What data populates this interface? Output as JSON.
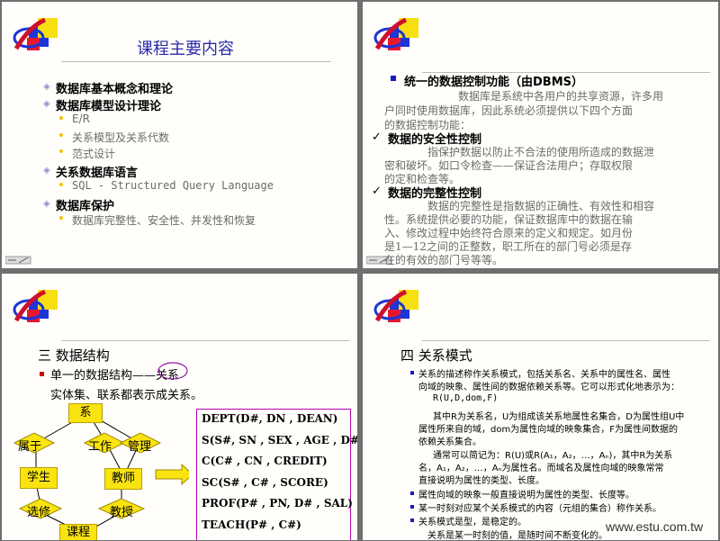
{
  "watermark": "www.estu.com.tw",
  "slide1": {
    "title": "课程主要内容",
    "items": [
      {
        "level": 1,
        "text": "数据库基本概念和理论"
      },
      {
        "level": 1,
        "text": "数据库模型设计理论"
      },
      {
        "level": 2,
        "text": "E/R"
      },
      {
        "level": 2,
        "text": "关系模型及关系代数"
      },
      {
        "level": 2,
        "text": "范式设计"
      },
      {
        "level": 1,
        "text": "关系数据库语言"
      },
      {
        "level": 2,
        "text": "SQL - Structured Query Language"
      },
      {
        "level": 1,
        "text": "数据库保护"
      },
      {
        "level": 2,
        "text": "数据库完整性、安全性、并发性和恢复"
      }
    ]
  },
  "slide2": {
    "heading": "统一的数据控制功能（由DBMS）",
    "intro": [
      "数据库是系统中各用户的共享资源，许多用",
      "户同时使用数据库，因此系统必须提供以下四个方面",
      "的数据控制功能："
    ],
    "security_title": "数据的安全性控制",
    "security_text": [
      "指保护数据以防止不合法的使用所造成的数据泄",
      "密和破坏。如口令检查——保证合法用户；存取权限",
      "的定和检查等。"
    ],
    "integrity_title": "数据的完整性控制",
    "integrity_text": [
      "数据的完整性是指数据的正确性、有效性和相容",
      "性。系统提供必要的功能，保证数据库中的数据在输",
      "入、修改过程中始终符合原来的定义和规定。如月份",
      "是1—12之间的正整数，职工所在的部门号必须是存",
      "在的有效的部门号等等。"
    ]
  },
  "slide3": {
    "title": "三 数据结构",
    "bullet": "单一的数据结构——关系",
    "sub": "实体集、联系都表示成关系。",
    "entities": {
      "xi": "系",
      "shu": "属于",
      "gongzuo": "工作",
      "guanli": "管理",
      "xuesheng": "学生",
      "jiaoshi": "教师",
      "xuanxiu": "选修",
      "jiaoshou": "教授",
      "kecheng": "课程"
    },
    "relations": [
      "DEPT(D#, DN , DEAN)",
      "S(S#, SN , SEX , AGE , D#)",
      "C(C# , CN , CREDIT)",
      "SC(S# , C# , SCORE)",
      "PROF(P# , PN, D# , SAL)",
      "TEACH(P# , C#)"
    ]
  },
  "slide4": {
    "title": "四 关系模式",
    "p1": [
      "关系的描述称作关系模式，包括关系名、关系中的属性名、属性",
      "向域的映象、属性间的数据依赖关系等。它可以形式化地表示为："
    ],
    "formula": "R(U,D,dom,F)",
    "p2": [
      "其中R为关系名，U为组成该关系地属性名集合，D为属性组U中",
      "属性所来自的域，dom为属性向域的映象集合，F为属性间数据的",
      "依赖关系集合。"
    ],
    "p3": [
      "通常可以简记为：R(U)或R(A₁，A₂，…，Aₙ)，其中R为关系",
      "名，A₁，A₂，…，Aₙ为属性名。而域名及属性向域的映象常常",
      "直接说明为属性的类型、长度。"
    ],
    "b2": "属性向域的映象一般直接说明为属性的类型、长度等。",
    "b3": "某一时刻对应某个关系模式的内容（元组的集合）称作关系。",
    "b4": "关系模式是型，是稳定的。",
    "b5": "关系是某一时刻的值，是随时间不断变化的。"
  }
}
